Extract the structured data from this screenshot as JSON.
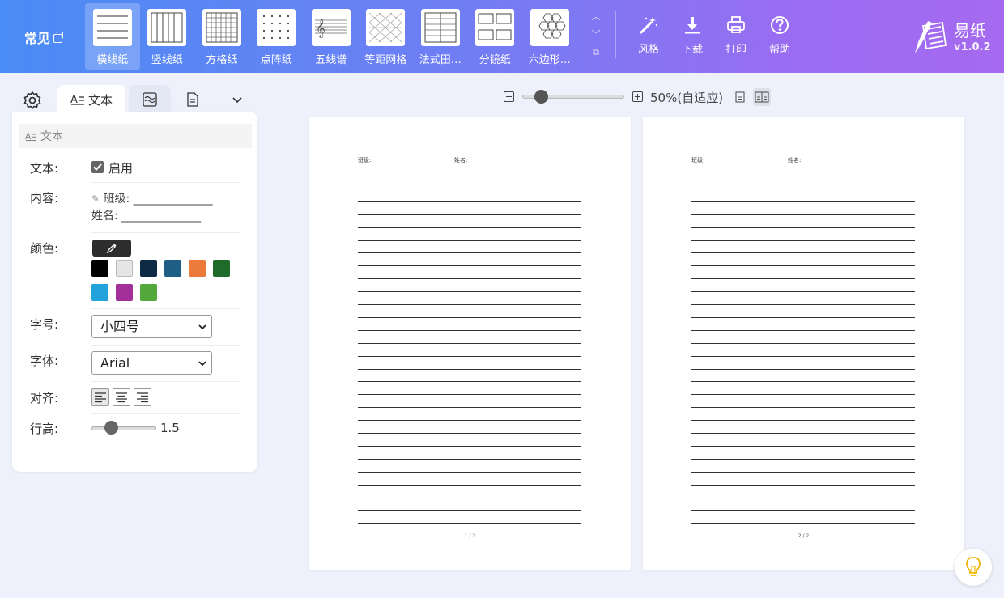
{
  "header": {
    "category": "常见",
    "papers": [
      {
        "label": "横线纸",
        "icon": "lined-paper-icon"
      },
      {
        "label": "竖线纸",
        "icon": "vertical-lined-paper-icon"
      },
      {
        "label": "方格纸",
        "icon": "grid-paper-icon"
      },
      {
        "label": "点阵纸",
        "icon": "dot-paper-icon"
      },
      {
        "label": "五线谱",
        "icon": "staff-paper-icon"
      },
      {
        "label": "等距网格",
        "icon": "isometric-grid-icon"
      },
      {
        "label": "法式田…",
        "icon": "french-grid-icon"
      },
      {
        "label": "分镜纸",
        "icon": "storyboard-paper-icon"
      },
      {
        "label": "六边形…",
        "icon": "hexagon-paper-icon"
      }
    ],
    "active_paper": "横线纸",
    "tools": [
      {
        "label": "风格",
        "icon": "magic-wand-icon"
      },
      {
        "label": "下载",
        "icon": "download-icon"
      },
      {
        "label": "打印",
        "icon": "printer-icon"
      },
      {
        "label": "帮助",
        "icon": "help-icon"
      }
    ],
    "app_name": "易纸",
    "version": "v1.0.2"
  },
  "panel": {
    "tabs": [
      {
        "label": "文本",
        "icon": "text-format-icon",
        "active": true
      },
      {
        "label": "",
        "icon": "wave-lines-icon",
        "active": false
      },
      {
        "label": "",
        "icon": "document-icon",
        "active": false
      }
    ],
    "section_title": "文本",
    "text_label": "文本:",
    "enable_label": "启用",
    "enabled": true,
    "content_label": "内容:",
    "content_lines": [
      "班级: ______________",
      "姓名: ______________"
    ],
    "color_label": "颜色:",
    "colors": [
      "#000000",
      "#e5e5e5",
      "#0f2a44",
      "#1f5f85",
      "#ec7a3a",
      "#1e6b2a",
      "#22a3dc",
      "#a3309a",
      "#52a83a"
    ],
    "size_label": "字号:",
    "size_value": "小四号",
    "font_label": "字体:",
    "font_value": "Arial",
    "align_label": "对齐:",
    "line_height_label": "行高:",
    "line_height_value": "1.5"
  },
  "zoom": {
    "value": "50%(自适应)",
    "level": 0.12
  },
  "pages": [
    {
      "class_label": "班级:",
      "name_label": "姓名:",
      "page_number": "1 / 2",
      "line_count": 28
    },
    {
      "class_label": "班级:",
      "name_label": "姓名:",
      "page_number": "2 / 2",
      "line_count": 28
    }
  ]
}
